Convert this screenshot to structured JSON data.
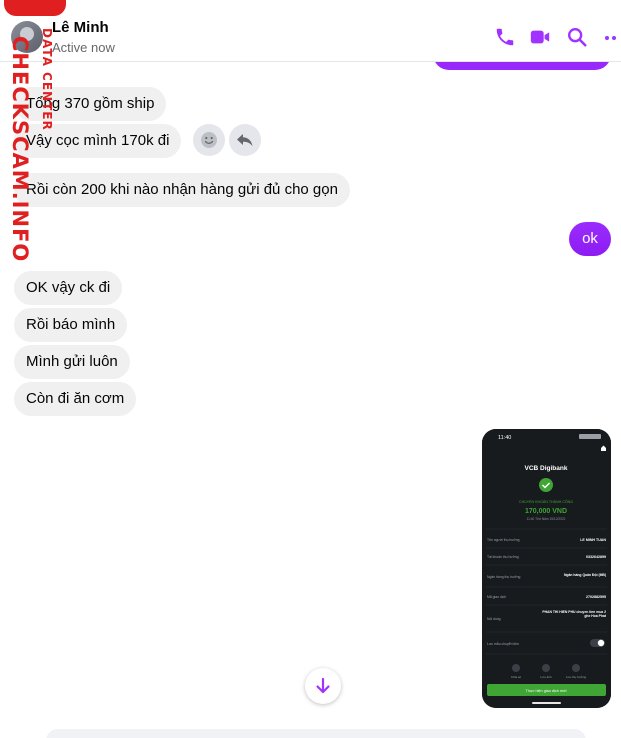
{
  "header": {
    "name": "Lê Minh",
    "status": "Active now"
  },
  "watermark": {
    "main": "CHECKSCAM.INFO",
    "sub": "DATA CENTER"
  },
  "messages": {
    "m1": "Tổng 370 gồm ship",
    "m2": "Vậy cọc mình 170k đi",
    "m3": "Rồi còn 200 khi nào nhận hàng gửi đủ cho gọn",
    "m4": "ok",
    "m5": "OK vậy ck đi",
    "m6": "Rồi báo mình",
    "m7": "Mình gửi luôn",
    "m8": "Còn đi ăn cơm"
  },
  "receipt": {
    "time": "11:40",
    "bank": "VCB Digibank",
    "status": "CHUYỂN KHOẢN THÀNH CÔNG",
    "amount": "170,000 VND",
    "datetime": "11:40 Thứ Năm 15/12/2022",
    "rows": [
      {
        "label": "Tên người thụ hưởng",
        "value": "LE MINH TUAN"
      },
      {
        "label": "Tài khoản thụ hưởng",
        "value": "0332642899"
      },
      {
        "label": "Ngân hàng thụ hưởng",
        "value": "Ngân hàng Quân Đội (MB)"
      },
      {
        "label": "Mã giao dịch",
        "value": "2702882595"
      },
      {
        "label": "Nội dung",
        "value": "PHAN THI HIEN PHU chuyen tien mua 2 ghe Hoa Phat"
      }
    ],
    "toggle_label": "Lưu mẫu chuyển tiền",
    "actions": [
      "Chia sẻ",
      "Lưu ảnh",
      "Lưu thụ hưởng"
    ],
    "button": "Thực hiện giao dịch mới"
  },
  "colors": {
    "accent": "#a033ff",
    "incoming": "#f0f0f0",
    "receipt_green": "#3fa535"
  }
}
